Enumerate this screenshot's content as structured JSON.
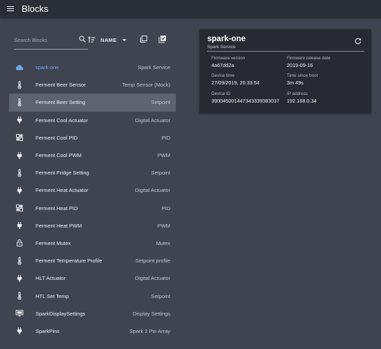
{
  "app": {
    "title": "Blocks"
  },
  "toolbar": {
    "search_placeholder": "Search Blocks",
    "sort_label": "NAME"
  },
  "blocks": [
    {
      "name": "spark-one",
      "type": "Spark Service",
      "icon": "cloud-icon"
    },
    {
      "name": "Ferment Beer Sensor",
      "type": "Temp Sensor (Mock)",
      "icon": "thermometer-icon"
    },
    {
      "name": "Ferment Beer Setting",
      "type": "Setpoint",
      "icon": "thermometer-icon",
      "selected": true
    },
    {
      "name": "Ferment Cool Actuator",
      "type": "Digital Actuator",
      "icon": "plug-icon"
    },
    {
      "name": "Ferment Cool PID",
      "type": "PID",
      "icon": "grid-icon"
    },
    {
      "name": "Ferment Cool PWM",
      "type": "PWM",
      "icon": "plug-icon"
    },
    {
      "name": "Ferment Fridge Setting",
      "type": "Setpoint",
      "icon": "thermometer-icon"
    },
    {
      "name": "Ferment Heat Actuator",
      "type": "Digital Actuator",
      "icon": "plug-icon"
    },
    {
      "name": "Ferment Heat PID",
      "type": "PID",
      "icon": "grid-icon"
    },
    {
      "name": "Ferment Heat PWM",
      "type": "PWM",
      "icon": "plug-icon"
    },
    {
      "name": "Ferment Mutex",
      "type": "Mutex",
      "icon": "lock-icon"
    },
    {
      "name": "Ferment Temperature Profile",
      "type": "Setpoint profile",
      "icon": "thermometer-icon"
    },
    {
      "name": "HLT Actuator",
      "type": "Digital Actuator",
      "icon": "plug-icon"
    },
    {
      "name": "HTL Set Temp",
      "type": "Setpoint",
      "icon": "thermometer-icon"
    },
    {
      "name": "SparkDisplaySettings",
      "type": "Display Settings",
      "icon": "monitor-icon"
    },
    {
      "name": "SparkPins",
      "type": "Spark 2 Pin Array",
      "icon": "plug-icon"
    }
  ],
  "service_card": {
    "title": "spark-one",
    "subtitle": "Spark Service",
    "firmware_version_label": "Firmware version",
    "firmware_version": "4a67dd2a",
    "firmware_release_label": "Firmware release date",
    "firmware_release": "2019-09-16",
    "device_time_label": "Device time",
    "device_time": "27/09/2019, 20:33:54",
    "time_since_boot_label": "Time since boot",
    "time_since_boot": "3m 49s",
    "device_id_label": "Device ID",
    "device_id": "390045001447343339383037",
    "ip_label": "IP address",
    "ip": "192.168.0.34"
  },
  "colors": {
    "accent": "#70a9ec",
    "background": "#3f4450",
    "appbar": "#2a2e36",
    "card": "#272a31",
    "selected_row": "#5d636f"
  }
}
